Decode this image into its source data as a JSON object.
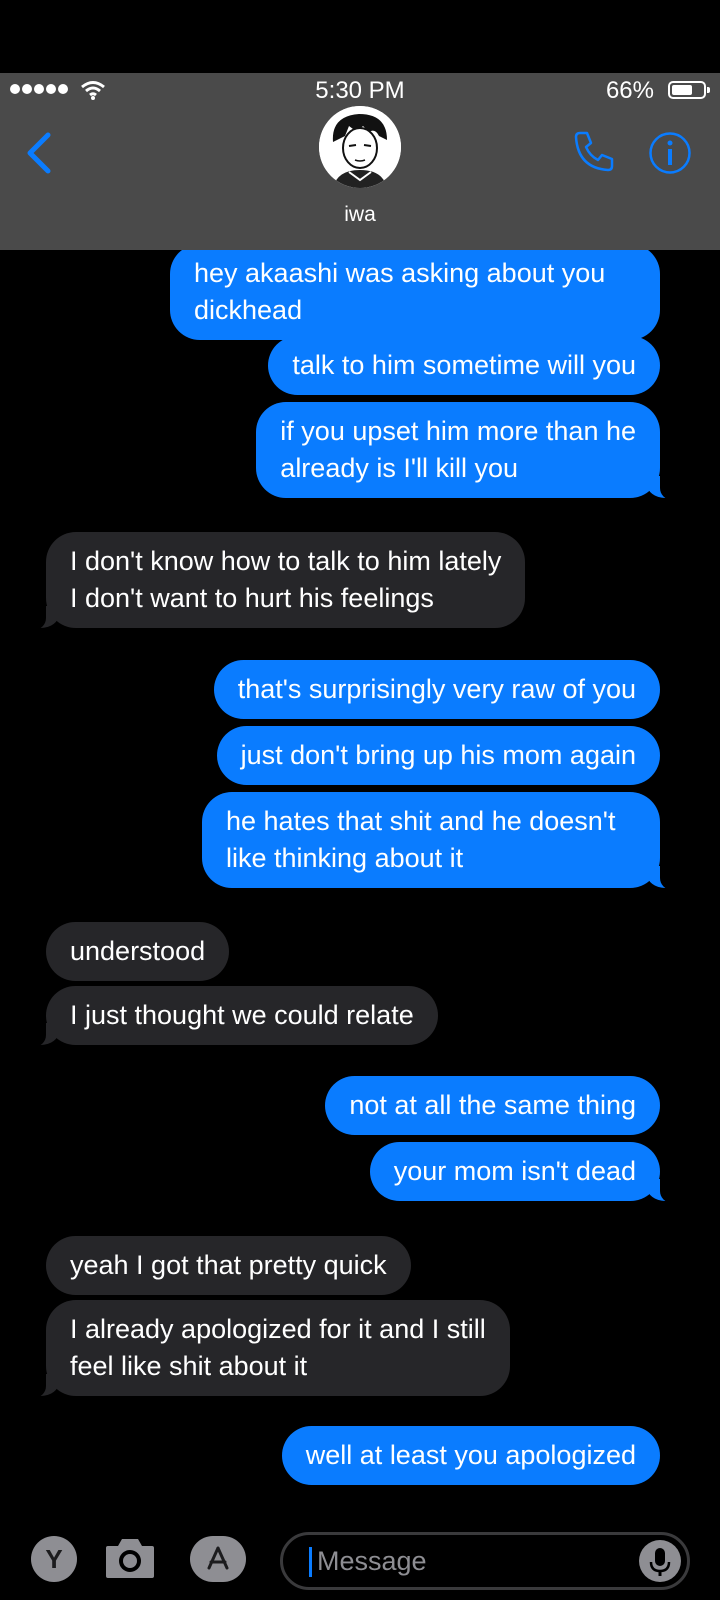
{
  "status_bar": {
    "time": "5:30 PM",
    "battery_percent": "66%",
    "battery_level": 0.66,
    "signal_bars": 5
  },
  "header": {
    "contact_name": "iwa",
    "back_icon": "chevron-left-icon",
    "call_icon": "phone-icon",
    "info_icon": "info-icon",
    "accent_color": "#0a7cff"
  },
  "messages": [
    {
      "from": "me",
      "text": "hey akaashi was asking about you\ndickhead"
    },
    {
      "from": "me",
      "text": "talk to him sometime will you"
    },
    {
      "from": "me",
      "text": "if you upset him more than he\nalready is I'll kill you"
    },
    {
      "from": "them",
      "text": "I don't know how to talk to him lately\nI don't want to hurt his feelings"
    },
    {
      "from": "me",
      "text": "that's surprisingly very raw of you"
    },
    {
      "from": "me",
      "text": "just don't bring up his mom again"
    },
    {
      "from": "me",
      "text": "he hates that shit and he doesn't\nlike thinking about it"
    },
    {
      "from": "them",
      "text": "understood"
    },
    {
      "from": "them",
      "text": "I just thought we could relate"
    },
    {
      "from": "me",
      "text": "not at all the same thing"
    },
    {
      "from": "me",
      "text": "your mom isn't dead"
    },
    {
      "from": "them",
      "text": "yeah I got that pretty quick"
    },
    {
      "from": "them",
      "text": "I already apologized for it and I still\nfeel like shit about it"
    },
    {
      "from": "me",
      "text": "well at least you apologized"
    }
  ],
  "composer": {
    "placeholder": "Message",
    "apps": [
      {
        "icon": "y-app-icon",
        "label": "Y"
      },
      {
        "icon": "camera-icon"
      },
      {
        "icon": "app-store-icon"
      }
    ],
    "mic_icon": "microphone-icon"
  },
  "colors": {
    "sent_bubble": "#0a7cff",
    "received_bubble": "#262629",
    "header_bg": "#4a4a4a",
    "background": "#000000"
  }
}
